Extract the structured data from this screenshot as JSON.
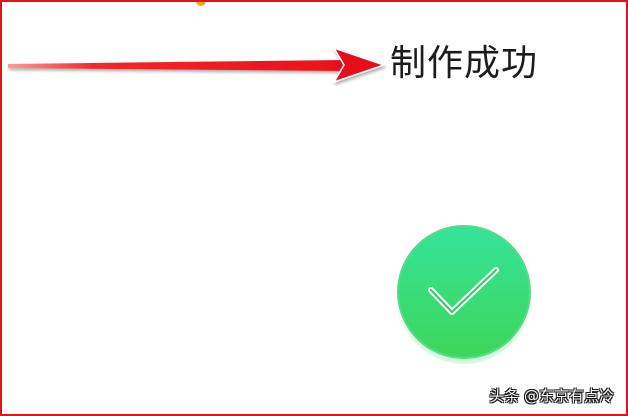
{
  "annotation": {
    "label": "制作成功",
    "arrow_color": "#e8101c"
  },
  "status": {
    "icon": "checkmark-icon",
    "badge_color": "#3edc6c"
  },
  "watermark": {
    "text": "头条 @东京有点冷"
  },
  "colors": {
    "frame_border": "#e0141a",
    "accent_dot": "#f7a427"
  }
}
